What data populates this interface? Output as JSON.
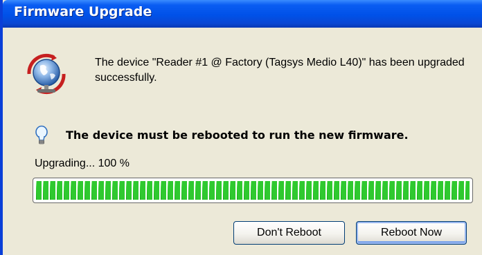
{
  "window": {
    "title": "Firmware Upgrade"
  },
  "dialog": {
    "message": "The device \"Reader #1 @ Factory (Tagsys Medio L40)\" has been upgraded successfully.",
    "warning": "The device must be rebooted to run the new firmware.",
    "status": "Upgrading... 100 %",
    "progress_fraction": 1.0,
    "icons": [
      "globe-network-icon",
      "lightbulb-icon"
    ],
    "colors": {
      "progress": "#2fc92f",
      "titlebar": "#0051e8",
      "background": "#ece9d8"
    }
  },
  "buttons": {
    "dont_reboot": "Don't Reboot",
    "reboot_now": "Reboot Now"
  }
}
